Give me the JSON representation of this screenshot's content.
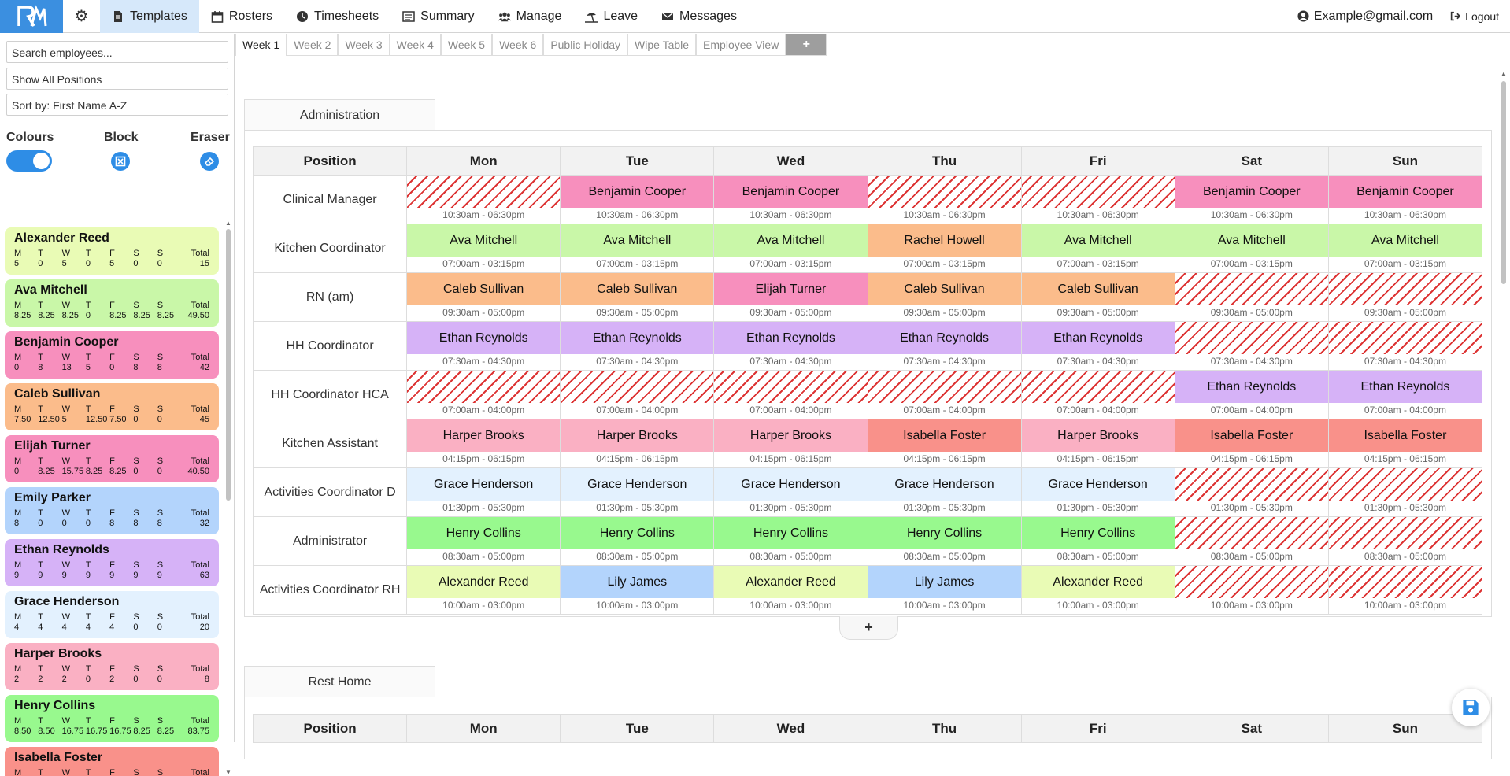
{
  "nav": {
    "logo": "RM",
    "items": [
      {
        "label": "Templates",
        "icon": "document-icon",
        "active": true
      },
      {
        "label": "Rosters",
        "icon": "calendar-icon"
      },
      {
        "label": "Timesheets",
        "icon": "clock-icon"
      },
      {
        "label": "Summary",
        "icon": "list-icon"
      },
      {
        "label": "Manage",
        "icon": "users-icon"
      },
      {
        "label": "Leave",
        "icon": "beach-icon"
      },
      {
        "label": "Messages",
        "icon": "envelope-icon"
      }
    ],
    "user": "Example@gmail.com",
    "logout": "Logout"
  },
  "sidebar": {
    "search_placeholder": "Search employees...",
    "positions_filter": "Show All Positions",
    "sort": "Sort by: First Name A-Z",
    "colours_label": "Colours",
    "block_label": "Block",
    "eraser_label": "Eraser",
    "day_letters": [
      "M",
      "T",
      "W",
      "T",
      "F",
      "S",
      "S"
    ],
    "total_label": "Total",
    "employees": [
      {
        "name": "Alexander Reed",
        "color": "#e9fbb5",
        "hours": [
          "5",
          "0",
          "5",
          "0",
          "5",
          "0",
          "0"
        ],
        "total": "15"
      },
      {
        "name": "Ava Mitchell",
        "color": "#c9f7a8",
        "hours": [
          "8.25",
          "8.25",
          "8.25",
          "0",
          "8.25",
          "8.25",
          "8.25"
        ],
        "total": "49.50"
      },
      {
        "name": "Benjamin Cooper",
        "color": "#f78fbd",
        "hours": [
          "0",
          "8",
          "13",
          "5",
          "0",
          "8",
          "8"
        ],
        "total": "42"
      },
      {
        "name": "Caleb Sullivan",
        "color": "#fbbc8b",
        "hours": [
          "7.50",
          "12.50",
          "5",
          "12.50",
          "7.50",
          "0",
          "0"
        ],
        "total": "45"
      },
      {
        "name": "Elijah Turner",
        "color": "#f78fbd",
        "hours": [
          "0",
          "8.25",
          "15.75",
          "8.25",
          "8.25",
          "0",
          "0"
        ],
        "total": "40.50"
      },
      {
        "name": "Emily Parker",
        "color": "#b3d4fc",
        "hours": [
          "8",
          "0",
          "0",
          "0",
          "8",
          "8",
          "8"
        ],
        "total": "32"
      },
      {
        "name": "Ethan Reynolds",
        "color": "#d6b2f7",
        "hours": [
          "9",
          "9",
          "9",
          "9",
          "9",
          "9",
          "9"
        ],
        "total": "63"
      },
      {
        "name": "Grace Henderson",
        "color": "#e3f1fe",
        "hours": [
          "4",
          "4",
          "4",
          "4",
          "4",
          "0",
          "0"
        ],
        "total": "20"
      },
      {
        "name": "Harper Brooks",
        "color": "#fab0c3",
        "hours": [
          "2",
          "2",
          "2",
          "0",
          "2",
          "0",
          "0"
        ],
        "total": "8"
      },
      {
        "name": "Henry Collins",
        "color": "#98f98e",
        "hours": [
          "8.50",
          "8.50",
          "16.75",
          "16.75",
          "16.75",
          "8.25",
          "8.25"
        ],
        "total": "83.75"
      },
      {
        "name": "Isabella Foster",
        "color": "#f9918a",
        "hours": [
          "",
          "",
          "",
          "",
          "",
          "",
          "",
          ""
        ],
        "total": ""
      }
    ]
  },
  "tabs": [
    {
      "label": "Week 1",
      "active": true
    },
    {
      "label": "Week 2"
    },
    {
      "label": "Week 3"
    },
    {
      "label": "Week 4"
    },
    {
      "label": "Week 5"
    },
    {
      "label": "Week 6"
    },
    {
      "label": "Public Holiday"
    },
    {
      "label": "Wipe Table"
    },
    {
      "label": "Employee View"
    },
    {
      "label": "+",
      "add": true
    }
  ],
  "headers": [
    "Position",
    "Mon",
    "Tue",
    "Wed",
    "Thu",
    "Fri",
    "Sat",
    "Sun"
  ],
  "colors": {
    "Alexander Reed": "#e9fbb5",
    "Ava Mitchell": "#c9f7a8",
    "Benjamin Cooper": "#f78fbd",
    "Caleb Sullivan": "#fbbc8b",
    "Rachel Howell": "#fbbc8b",
    "Elijah Turner": "#f78fbd",
    "Ethan Reynolds": "#d6b2f7",
    "Grace Henderson": "#e3f1fe",
    "Harper Brooks": "#fab0c3",
    "Henry Collins": "#98f98e",
    "Isabella Foster": "#f9918a",
    "Lily James": "#b3d4fc"
  },
  "sections": [
    {
      "name": "Administration",
      "rows": [
        {
          "position": "Clinical Manager",
          "time": "10:30am - 06:30pm",
          "cells": [
            "",
            "Benjamin Cooper",
            "Benjamin Cooper",
            "",
            "",
            "Benjamin Cooper",
            "Benjamin Cooper"
          ]
        },
        {
          "position": "Kitchen Coordinator",
          "time": "07:00am - 03:15pm",
          "cells": [
            "Ava Mitchell",
            "Ava Mitchell",
            "Ava Mitchell",
            "Rachel Howell",
            "Ava Mitchell",
            "Ava Mitchell",
            "Ava Mitchell"
          ]
        },
        {
          "position": "RN (am)",
          "time": "09:30am - 05:00pm",
          "cells": [
            "Caleb Sullivan",
            "Caleb Sullivan",
            "Elijah Turner",
            "Caleb Sullivan",
            "Caleb Sullivan",
            "",
            ""
          ]
        },
        {
          "position": "HH Coordinator",
          "time": "07:30am - 04:30pm",
          "cells": [
            "Ethan Reynolds",
            "Ethan Reynolds",
            "Ethan Reynolds",
            "Ethan Reynolds",
            "Ethan Reynolds",
            "",
            ""
          ]
        },
        {
          "position": "HH Coordinator HCA",
          "time": "07:00am - 04:00pm",
          "cells": [
            "",
            "",
            "",
            "",
            "",
            "Ethan Reynolds",
            "Ethan Reynolds"
          ]
        },
        {
          "position": "Kitchen Assistant",
          "time": "04:15pm - 06:15pm",
          "cells": [
            "Harper Brooks",
            "Harper Brooks",
            "Harper Brooks",
            "Isabella Foster",
            "Harper Brooks",
            "Isabella Foster",
            "Isabella Foster"
          ]
        },
        {
          "position": "Activities Coordinator D",
          "time": "01:30pm - 05:30pm",
          "cells": [
            "Grace Henderson",
            "Grace Henderson",
            "Grace Henderson",
            "Grace Henderson",
            "Grace Henderson",
            "",
            ""
          ]
        },
        {
          "position": "Administrator",
          "time": "08:30am - 05:00pm",
          "cells": [
            "Henry Collins",
            "Henry Collins",
            "Henry Collins",
            "Henry Collins",
            "Henry Collins",
            "",
            ""
          ]
        },
        {
          "position": "Activities Coordinator RH",
          "time": "10:00am - 03:00pm",
          "cells": [
            "Alexander Reed",
            "Lily James",
            "Alexander Reed",
            "Lily James",
            "Alexander Reed",
            "",
            ""
          ]
        }
      ],
      "add_label": "+"
    },
    {
      "name": "Rest Home",
      "rows": []
    }
  ]
}
